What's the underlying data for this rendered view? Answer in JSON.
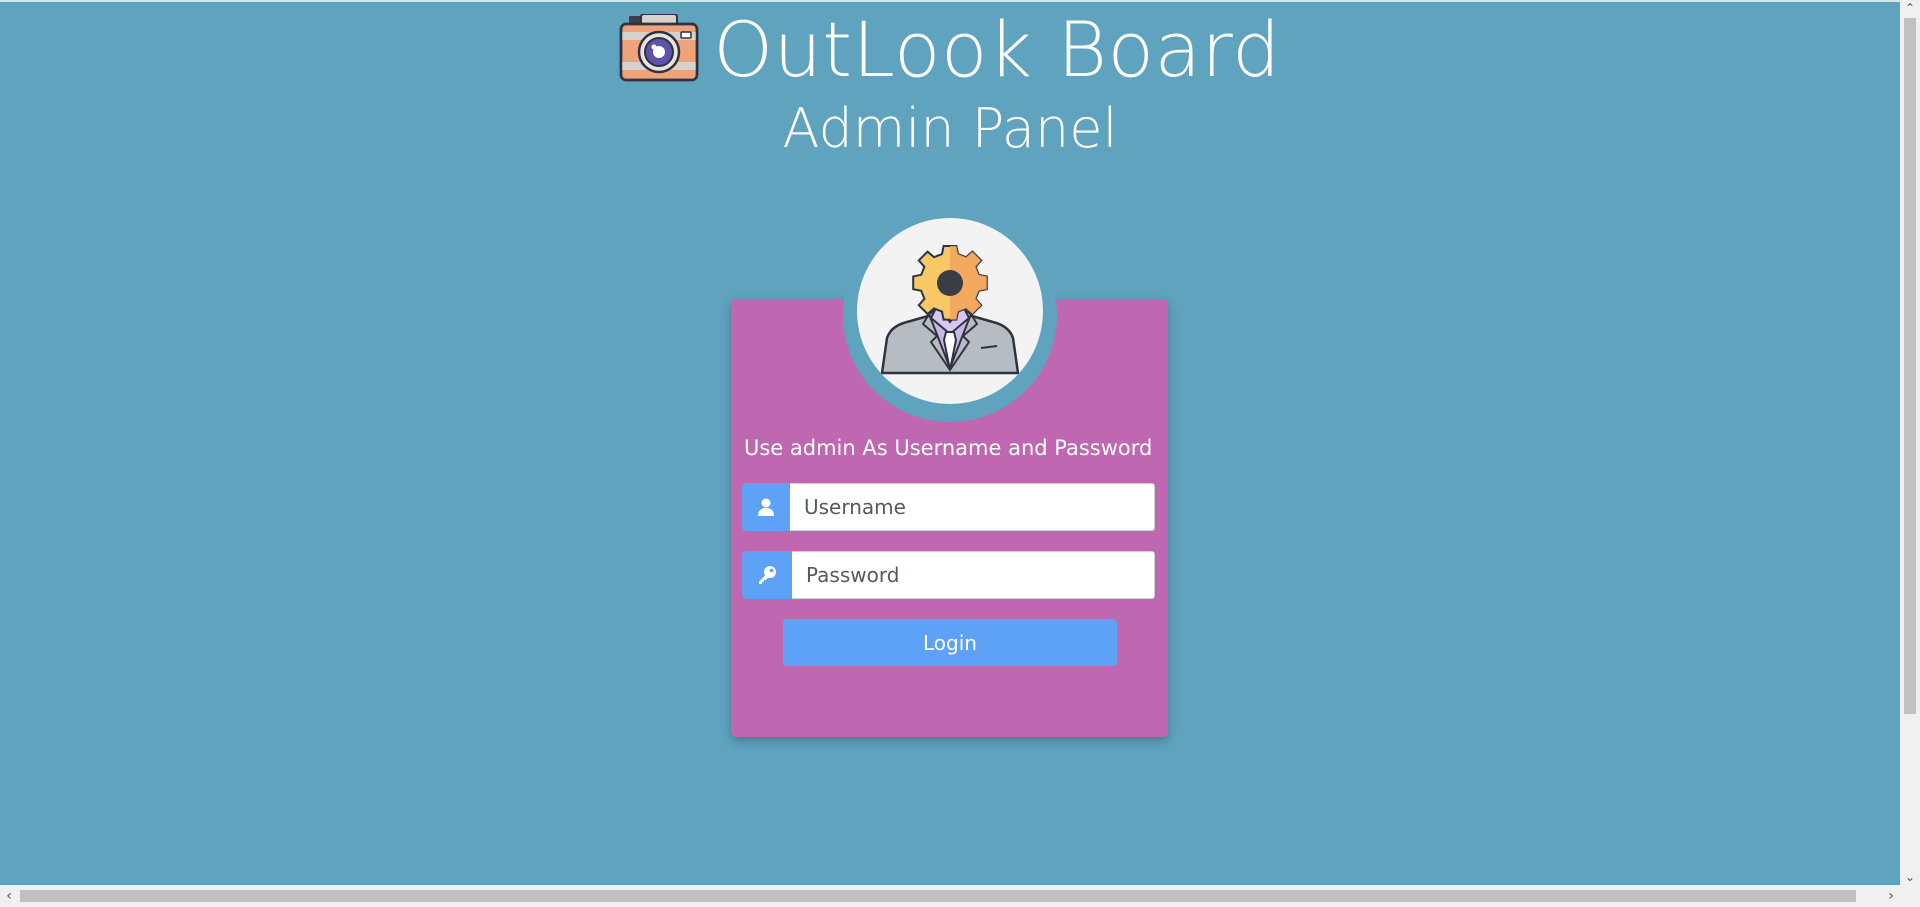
{
  "header": {
    "brand_title": "OutLook Board",
    "logo_icon": "camera-icon",
    "sub_title": "Admin Panel"
  },
  "login": {
    "avatar_icon": "admin-gear-avatar-icon",
    "hint": "Use admin As Username and Password",
    "username": {
      "icon": "user-icon",
      "placeholder": "Username",
      "value": ""
    },
    "password": {
      "icon": "key-icon",
      "placeholder": "Password",
      "value": ""
    },
    "submit_label": "Login"
  },
  "colors": {
    "page_background": "#5fa3bf",
    "card_background": "#bf68b1",
    "accent": "#5da2f7",
    "text_light": "#ffffff"
  }
}
